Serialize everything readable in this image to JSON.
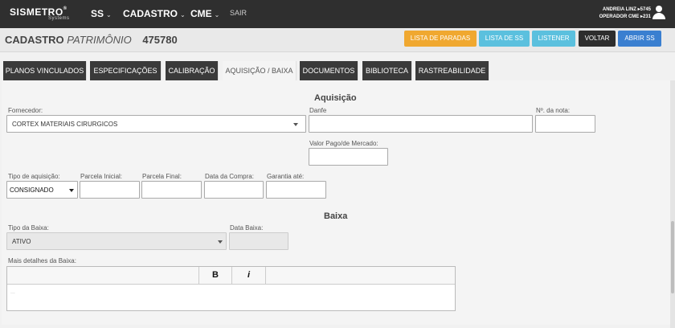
{
  "topnav": {
    "brand": "SISMETRO",
    "brand_reg": "®",
    "brand_sub": "Systems",
    "items": [
      {
        "label": "SS",
        "caret": "⌄"
      },
      {
        "label": "CADASTRO",
        "caret": "⌄"
      },
      {
        "label": "CME",
        "caret": "⌄"
      }
    ],
    "sair": "SAIR",
    "user_line1": "ANDREIA LINZ ▸5745",
    "user_line2": "OPERADOR CME ▸231",
    "user_icon": "user-icon"
  },
  "header": {
    "title_main": "CADASTRO",
    "title_italic": "PATRIMÔNIO",
    "title_number": "475780",
    "buttons": [
      {
        "label": "LISTA DE PARADAS",
        "color": "#f0a830"
      },
      {
        "label": "LISTA DE SS",
        "color": "#5bc0de"
      },
      {
        "label": "LISTENER",
        "color": "#5bc0de"
      },
      {
        "label": "VOLTAR",
        "color": "#2d2d2d"
      },
      {
        "label": "ABRIR SS",
        "color": "#3a7fd0"
      }
    ]
  },
  "tabs": [
    {
      "label": "PLANOS VINCULADOS",
      "active": false
    },
    {
      "label": "ESPECIFICAÇÕES",
      "active": false
    },
    {
      "label": "CALIBRAÇÃO",
      "active": false
    },
    {
      "label": "AQUISIÇÃO / BAIXA",
      "active": true
    },
    {
      "label": "DOCUMENTOS",
      "active": false
    },
    {
      "label": "BIBLIOTECA",
      "active": false
    },
    {
      "label": "RASTREABILIDADE",
      "active": false
    }
  ],
  "aquisicao": {
    "title": "Aquisição",
    "fornecedor_label": "Fornecedor:",
    "fornecedor_value": "CORTEX MATERIAIS CIRURGICOS",
    "danfe_label": "Danfe",
    "danfe_value": "",
    "nota_label": "Nº. da nota:",
    "nota_value": "",
    "valor_label": "Valor Pago/de Mercado:",
    "valor_value": "",
    "tipo_label": "Tipo de aquisição:",
    "tipo_value": "CONSIGNADO",
    "parcela_inicial_label": "Parcela Inicial:",
    "parcela_final_label": "Parcela Final:",
    "data_compra_label": "Data da Compra:",
    "garantia_label": "Garantia até:"
  },
  "baixa": {
    "title": "Baixa",
    "tipo_label": "Tipo da Baixa:",
    "tipo_value": "ATIVO",
    "data_label": "Data Baixa:",
    "detalhes_label": "Mais detalhes da Baixa:",
    "bold_label": "B",
    "italic_label": "i",
    "editor_placeholder": "..."
  }
}
